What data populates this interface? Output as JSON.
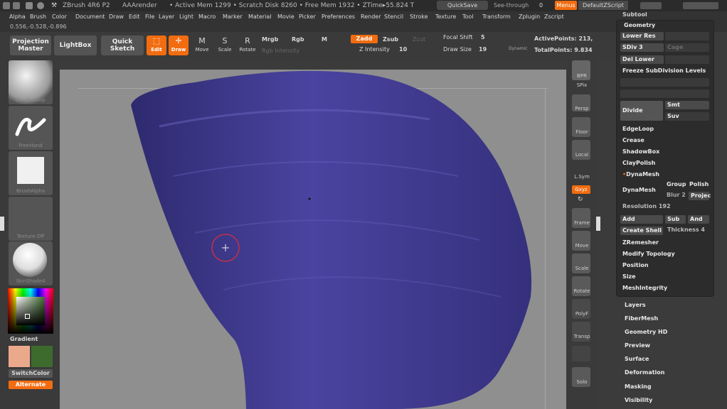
{
  "titlebar": {
    "app": "ZBrush 4R6 P2",
    "renderer": "AAArender",
    "stats": "• Active Mem 1299 • Scratch Disk 8260 • Free Mem 1932 • ZTime▸55.824 T",
    "quicksave": "QuickSave",
    "seethrough": "See-through",
    "seethrough_val": "0",
    "menus_btn": "Menus",
    "script": "DefaultZScript"
  },
  "menu": [
    "Alpha",
    "Brush",
    "Color",
    "Document",
    "Draw",
    "Edit",
    "File",
    "Layer",
    "Light",
    "Macro",
    "Marker",
    "Material",
    "Movie",
    "Picker",
    "Preferences",
    "Render",
    "Stencil",
    "Stroke",
    "Texture",
    "Tool",
    "Transform",
    "Zplugin",
    "Zscript"
  ],
  "coords": "0.556,-0.528,-0.896",
  "toolbar": {
    "projection_master": "Projection Master",
    "lightbox": "LightBox",
    "quick_sketch": "Quick Sketch",
    "edit": "Edit",
    "draw": "Draw",
    "move": "Move",
    "scale": "Scale",
    "rotate": "Rotate",
    "mrgb": "Mrgb",
    "rgb": "Rgb",
    "m": "M",
    "rgb_intensity": "Rgb Intensity",
    "zadd": "Zadd",
    "zsub": "Zsub",
    "zcut": "Zcut",
    "z_intensity_label": "Z Intensity",
    "z_intensity_val": "10",
    "focal_shift_label": "Focal Shift",
    "focal_shift_val": "5",
    "draw_size_label": "Draw Size",
    "draw_size_val": "19",
    "dynamic": "Dynamic",
    "active_points": "ActivePoints: 213,",
    "total_points": "TotalPoints: 9.834"
  },
  "left_tray": {
    "brush1": "ClayBuildup",
    "brush2": "FreeHand",
    "alpha": "BrushAlpha",
    "texture": "Texture Off",
    "material": "SkinShade4",
    "gradient": "Gradient",
    "switch_color": "SwitchColor",
    "alternate": "Alternate"
  },
  "right_tray": [
    "BPR",
    "SPix",
    "Persp",
    "Floor",
    "Local",
    "L.Sym",
    "Gxyz",
    "Frame",
    "Move",
    "Scale",
    "Rotate",
    "PolyF",
    "Transp",
    "Solo"
  ],
  "subtool_panel": {
    "header": "Subtool",
    "geometry": "Geometry",
    "lower_res": "Lower Res",
    "sdiv": "SDiv",
    "sdiv_val": "3",
    "cage": "Cage",
    "del_lower": "Del Lower",
    "freeze_subdiv": "Freeze SubDivision Levels",
    "divide": "Divide",
    "smt": "Smt",
    "suv": "Suv",
    "edgeloop": "EdgeLoop",
    "crease": "Crease",
    "shadowbox": "ShadowBox",
    "claypolish": "ClayPolish",
    "dynamesh_sect": "DynaMesh",
    "dynamesh_btn": "DynaMesh",
    "group": "Group",
    "polish": "Polish",
    "blur": "Blur",
    "blur_val": "2",
    "project": "Projec",
    "resolution_label": "Resolution",
    "resolution_val": "192",
    "add": "Add",
    "sub": "Sub",
    "and": "And",
    "create_shell": "Create Shell",
    "thickness_label": "Thickness",
    "thickness_val": "4",
    "zremesher": "ZRemesher",
    "modify_topology": "Modify Topology",
    "position": "Position",
    "size": "Size",
    "meshintegrity": "MeshIntegrity"
  },
  "sections": [
    "Layers",
    "FiberMesh",
    "Geometry HD",
    "Preview",
    "Surface",
    "Deformation",
    "Masking",
    "Visibility"
  ],
  "colors": {
    "accent": "#f26c10",
    "mesh": "#3f3a8c",
    "canvas": "#8f8f8f"
  }
}
